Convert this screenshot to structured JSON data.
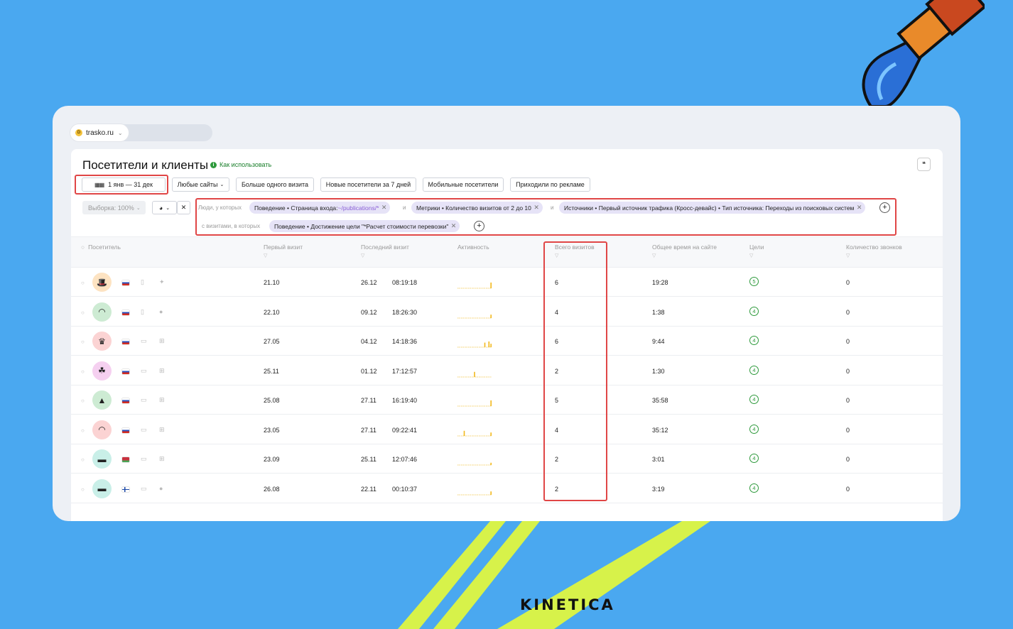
{
  "site": {
    "name": "trasko.ru"
  },
  "page": {
    "title": "Посетители и клиенты",
    "help_link": "Как использовать"
  },
  "toolbar": {
    "date_range": "1 янв — 31 дек",
    "sites": "Любые сайты",
    "segments": [
      "Больше одного визита",
      "Новые посетители за 7 дней",
      "Мобильные посетители",
      "Приходили по рекламе"
    ],
    "sample": "Выборка: 100%"
  },
  "filters": {
    "people_label": "Люди, у которых",
    "conjunction": "и",
    "chip1_prefix": "Поведение • Страница входа: ",
    "chip1_value": "~/publications/*",
    "chip2": "Метрики • Количество визитов от 2 до 10",
    "chip3": "Источники • Первый источник трафика (Кросс-девайс) • Тип источника: Переходы из поисковых систем",
    "visits_label": "с визитами, в которых",
    "chip4": "Поведение • Достижение цели \"*Расчет стоимости перевозки\""
  },
  "columns": {
    "visitor": "Посетитель",
    "first_visit": "Первый визит",
    "last_visit": "Последний визит",
    "activity": "Активность",
    "total_visits": "Всего визитов",
    "total_time": "Общее время на сайте",
    "goals": "Цели",
    "calls": "Количество звонков"
  },
  "rows": [
    {
      "avatar_icon": "hat-icon",
      "avatar_color": "#fde3c2",
      "flag": "ru",
      "device": "mobile",
      "os": "android",
      "first": "21.10",
      "last_date": "26.12",
      "last_time": "08:19:18",
      "visits": "6",
      "time": "19:28",
      "goals": "5",
      "calls": "0"
    },
    {
      "avatar_icon": "cap-icon",
      "avatar_color": "#cdebd3",
      "flag": "ru",
      "device": "mobile",
      "os": "apple",
      "first": "22.10",
      "last_date": "09.12",
      "last_time": "18:26:30",
      "visits": "4",
      "time": "1:38",
      "goals": "4",
      "calls": "0"
    },
    {
      "avatar_icon": "crown-icon",
      "avatar_color": "#fbd3d3",
      "flag": "ru",
      "device": "desktop",
      "os": "windows",
      "first": "27.05",
      "last_date": "04.12",
      "last_time": "14:18:36",
      "visits": "6",
      "time": "9:44",
      "goals": "4",
      "calls": "0"
    },
    {
      "avatar_icon": "mouse-icon",
      "avatar_color": "#f5d0f0",
      "flag": "ru",
      "device": "desktop",
      "os": "windows",
      "first": "25.11",
      "last_date": "01.12",
      "last_time": "17:12:57",
      "visits": "2",
      "time": "1:30",
      "goals": "4",
      "calls": "0"
    },
    {
      "avatar_icon": "helmet-icon",
      "avatar_color": "#cdebd3",
      "flag": "ru",
      "device": "desktop",
      "os": "windows",
      "first": "25.08",
      "last_date": "27.11",
      "last_time": "16:19:40",
      "visits": "5",
      "time": "35:58",
      "goals": "4",
      "calls": "0"
    },
    {
      "avatar_icon": "cap-icon",
      "avatar_color": "#fbd3d3",
      "flag": "ru",
      "device": "desktop",
      "os": "windows",
      "first": "23.05",
      "last_date": "27.11",
      "last_time": "09:22:41",
      "visits": "4",
      "time": "35:12",
      "goals": "4",
      "calls": "0"
    },
    {
      "avatar_icon": "top-hat-icon",
      "avatar_color": "#c9efe8",
      "flag": "by",
      "device": "desktop",
      "os": "windows",
      "first": "23.09",
      "last_date": "25.11",
      "last_time": "12:07:46",
      "visits": "2",
      "time": "3:01",
      "goals": "4",
      "calls": "0"
    },
    {
      "avatar_icon": "top-hat-icon",
      "avatar_color": "#c9efe8",
      "flag": "fi",
      "device": "desktop",
      "os": "apple",
      "first": "26.08",
      "last_date": "22.11",
      "last_time": "00:10:37",
      "visits": "2",
      "time": "3:19",
      "goals": "4",
      "calls": "0"
    }
  ],
  "brand": "KINETICA",
  "colors": {
    "background": "#4aa8f0",
    "highlight": "#e04646",
    "accent_lime": "#d7f24a",
    "goal_green": "#2e9a3c",
    "chip": "#e6e3f7"
  }
}
